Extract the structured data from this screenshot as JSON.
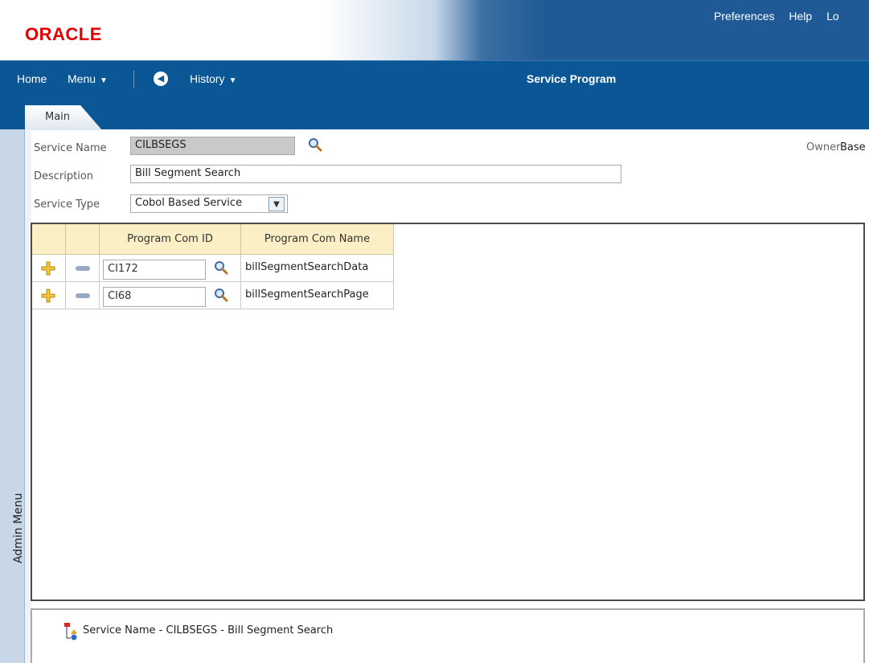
{
  "app": {
    "logo": "ORACLE",
    "top_links": [
      "Preferences",
      "Help",
      "Lo"
    ]
  },
  "nav": {
    "home": "Home",
    "menu": "Menu",
    "history": "History",
    "page_title": "Service Program"
  },
  "tabs": [
    {
      "label": "Main",
      "active": true
    }
  ],
  "side_menu": {
    "label": "Admin Menu"
  },
  "form": {
    "service_name_label": "Service Name",
    "service_name_value": "CILBSEGS",
    "description_label": "Description",
    "description_value": "Bill Segment Search",
    "service_type_label": "Service Type",
    "service_type_value": "Cobol Based Service",
    "owner_label": "Owner",
    "owner_value": "Base"
  },
  "grid": {
    "columns": [
      "Program Com ID",
      "Program Com Name"
    ],
    "rows": [
      {
        "program_com_id": "CI172",
        "program_com_name": "billSegmentSearchData"
      },
      {
        "program_com_id": "CI68",
        "program_com_name": "billSegmentSearchPage"
      }
    ]
  },
  "tree": {
    "node_text": "Service Name - CILBSEGS - Bill Segment Search"
  },
  "colors": {
    "brand_red": "#e40000",
    "nav_blue": "#0b5695",
    "grid_header": "#fbefc6"
  }
}
